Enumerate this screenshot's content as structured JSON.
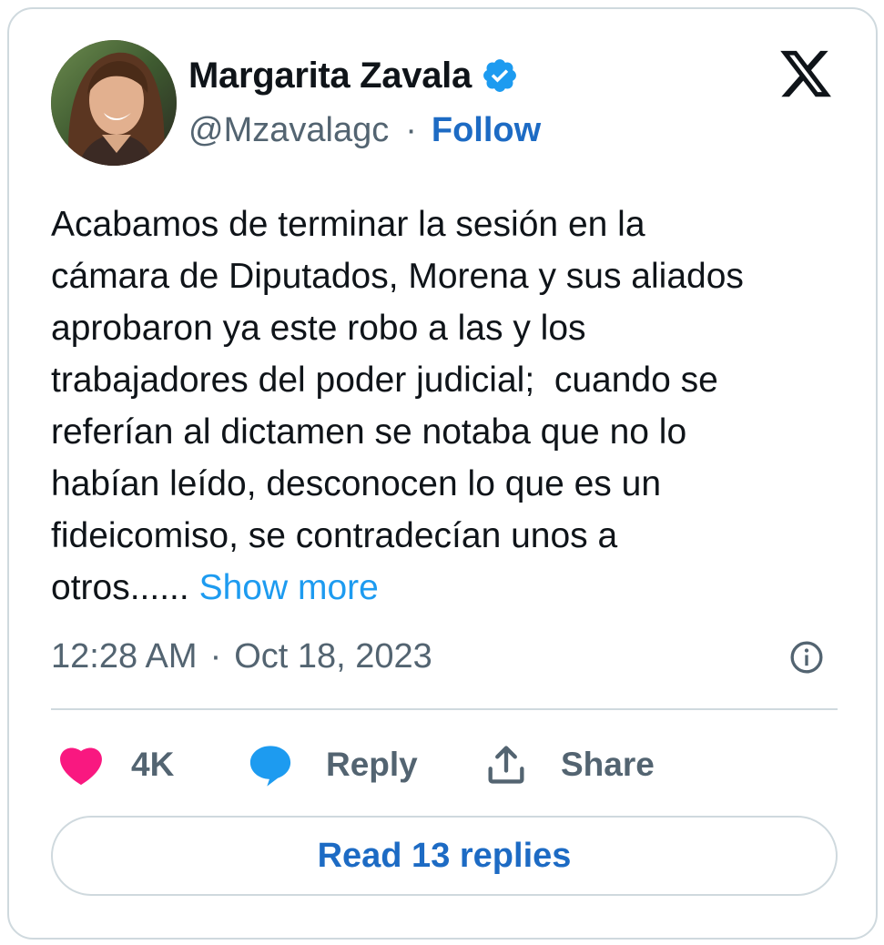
{
  "author": {
    "name": "Margarita Zavala",
    "handle": "@Mzavalagc",
    "separator": "·",
    "follow_label": "Follow",
    "verified": true
  },
  "tweet": {
    "text": "Acabamos de terminar la sesión en la\ncámara de Diputados, Morena y sus aliados\naprobaron ya este robo a las y los\ntrabajadores del poder judicial;  cuando se\nreferían al dictamen se notaba que no lo\nhabían leído, desconocen lo que es un\nfideicomiso, se contradecían unos a\notros...... ",
    "show_more_label": "Show more"
  },
  "meta": {
    "time": "12:28 AM",
    "separator": "·",
    "date": "Oct 18, 2023"
  },
  "actions": {
    "likes": "4K",
    "reply_label": "Reply",
    "share_label": "Share"
  },
  "read_replies_label": "Read 13 replies",
  "icons": {
    "logo": "x-logo-icon",
    "verified": "verified-badge-icon",
    "info": "info-icon",
    "like": "heart-icon",
    "reply": "speech-bubble-icon",
    "share": "share-upload-icon"
  },
  "colors": {
    "accent": "#1d9bf0",
    "link": "#1d6bc4",
    "like": "#f91880",
    "reply": "#1d9bf0",
    "muted": "#536471",
    "border": "#cfd9de",
    "text": "#0f1419"
  }
}
